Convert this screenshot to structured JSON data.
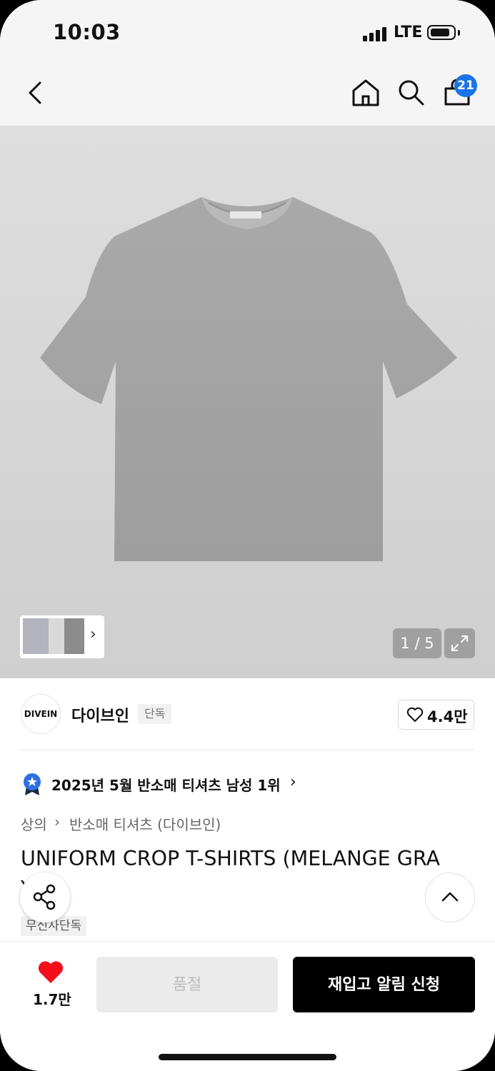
{
  "status_bar": {
    "time": "10:03",
    "network": "LTE"
  },
  "header": {
    "cart_count": "21"
  },
  "gallery": {
    "counter": "1 / 5"
  },
  "brand": {
    "logo_text": "DIVEIN",
    "name": "다이브인",
    "badge": "단독",
    "likes": "4.4만"
  },
  "ranking": {
    "text": "2025년 5월 반소매 티셔츠 남성 1위"
  },
  "breadcrumb": {
    "level1": "상의",
    "level2": "반소매 티셔츠 (다이브인)"
  },
  "product": {
    "title": "UNIFORM CROP T-SHIRTS (MELANGE GRA",
    "title_line2": "Y)",
    "tag": "무신사단독"
  },
  "bottom_bar": {
    "wish_count": "1.7만",
    "soldout_label": "품절",
    "restock_label": "재입고 알림 신청"
  },
  "colors": {
    "accent_blue": "#1a73e8",
    "heart_red": "#f40f1c",
    "primary_black": "#000000",
    "disabled_bg": "#ebebeb"
  }
}
